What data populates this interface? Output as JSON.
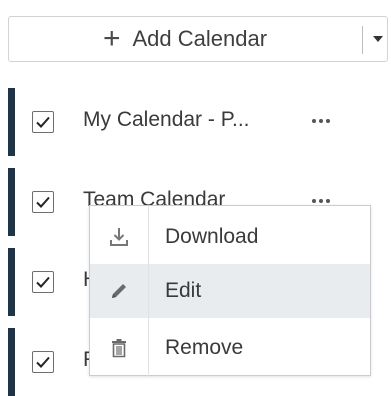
{
  "add_calendar": {
    "label": "Add Calendar",
    "plus_glyph": "+",
    "caret_icon": "caret-down-icon"
  },
  "calendars": [
    {
      "label": "My Calendar - P...",
      "checked": true,
      "color": "#1e3448"
    },
    {
      "label": "Team Calendar",
      "checked": true,
      "color": "#1e3448"
    },
    {
      "label": "H",
      "checked": true,
      "color": "#1e3448"
    },
    {
      "label": "F",
      "checked": true,
      "color": "#1e3448"
    }
  ],
  "context_menu": {
    "items": [
      {
        "label": "Download",
        "icon": "download-icon"
      },
      {
        "label": "Edit",
        "icon": "pencil-icon",
        "hovered": true
      },
      {
        "label": "Remove",
        "icon": "trash-icon"
      }
    ]
  }
}
